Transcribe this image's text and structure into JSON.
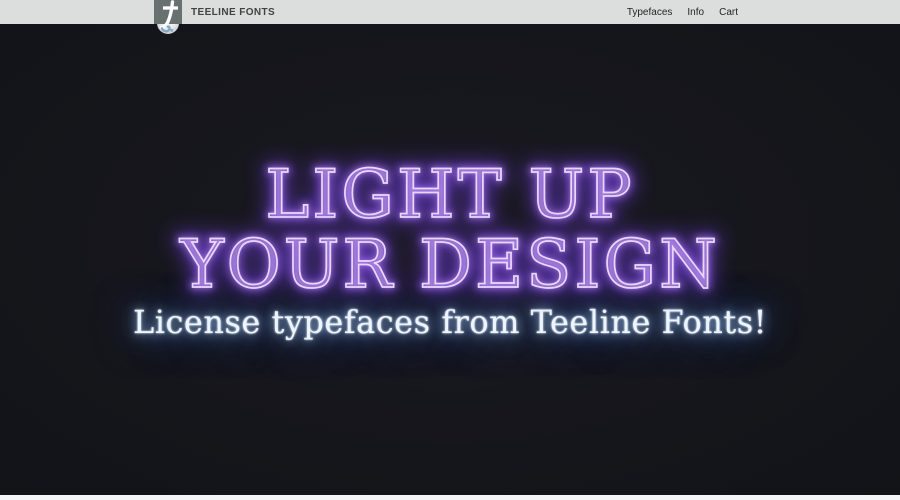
{
  "brand": {
    "name": "TEELINE FONTS"
  },
  "nav": {
    "links": [
      {
        "label": "Typefaces"
      },
      {
        "label": "Info"
      },
      {
        "label": "Cart"
      }
    ]
  },
  "hero": {
    "title_line1": "LIGHT UP",
    "title_line2": "YOUR DESIGN",
    "subtitle": "License typefaces from Teeline Fonts!"
  },
  "colors": {
    "navbar_bg": "#dcdedd",
    "hero_bg": "#14161a",
    "neon_purple_core": "#ead9fd",
    "neon_purple_mid": "#9d6bf0",
    "neon_purple_deep": "#6a3bd0",
    "neon_blue_core": "#edf5fe",
    "neon_blue_mid": "#9cc4f2",
    "neon_blue_deep": "#5e92dd",
    "next_section_bg": "#f4f5f7",
    "logo_square": "#687170",
    "logo_accent": "#82aac2",
    "nav_text": "#3e4444"
  }
}
